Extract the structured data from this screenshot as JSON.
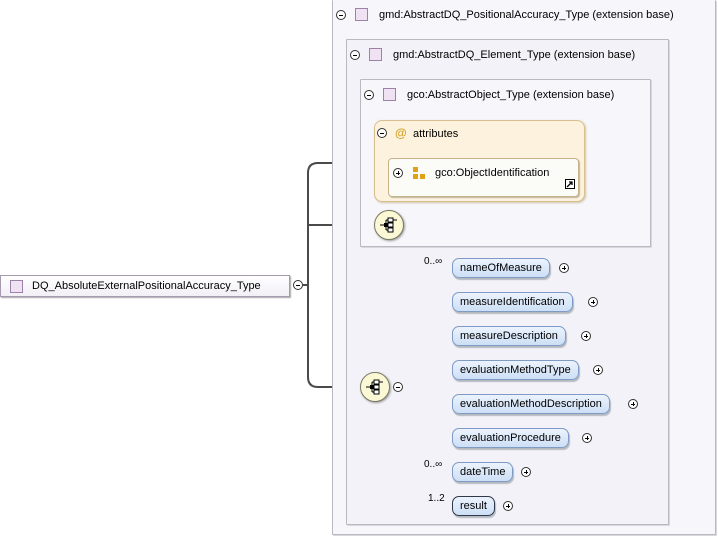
{
  "root": {
    "label": "DQ_AbsoluteExternalPositionalAccuracy_Type"
  },
  "panels": {
    "positional": {
      "title": "gmd:AbstractDQ_PositionalAccuracy_Type (extension base)"
    },
    "element": {
      "title": "gmd:AbstractDQ_Element_Type (extension base)"
    },
    "object": {
      "title": "gco:AbstractObject_Type (extension base)"
    }
  },
  "attributes": {
    "symbol": "@",
    "label": "attributes",
    "group_label": "gco:ObjectIdentification"
  },
  "elements": [
    {
      "label": "nameOfMeasure",
      "occurs": "0..∞",
      "required": false
    },
    {
      "label": "measureIdentification",
      "occurs": "",
      "required": false
    },
    {
      "label": "measureDescription",
      "occurs": "",
      "required": false
    },
    {
      "label": "evaluationMethodType",
      "occurs": "",
      "required": false
    },
    {
      "label": "evaluationMethodDescription",
      "occurs": "",
      "required": false
    },
    {
      "label": "evaluationProcedure",
      "occurs": "",
      "required": false
    },
    {
      "label": "dateTime",
      "occurs": "0..∞",
      "required": false
    },
    {
      "label": "result",
      "occurs": "1..2",
      "required": true
    }
  ],
  "colors": {
    "type_icon": "#efe3f3",
    "attributes_bg": "#fdf2dd",
    "element_bg": "#dce8f9",
    "compositor_bg": "#fbf8d6",
    "connector": "#4a4a4a"
  },
  "icons": {
    "compositor": "sequence-compositor-icon",
    "attribute_group": "attribute-group-icon",
    "reference": "reference-arrow-icon"
  }
}
